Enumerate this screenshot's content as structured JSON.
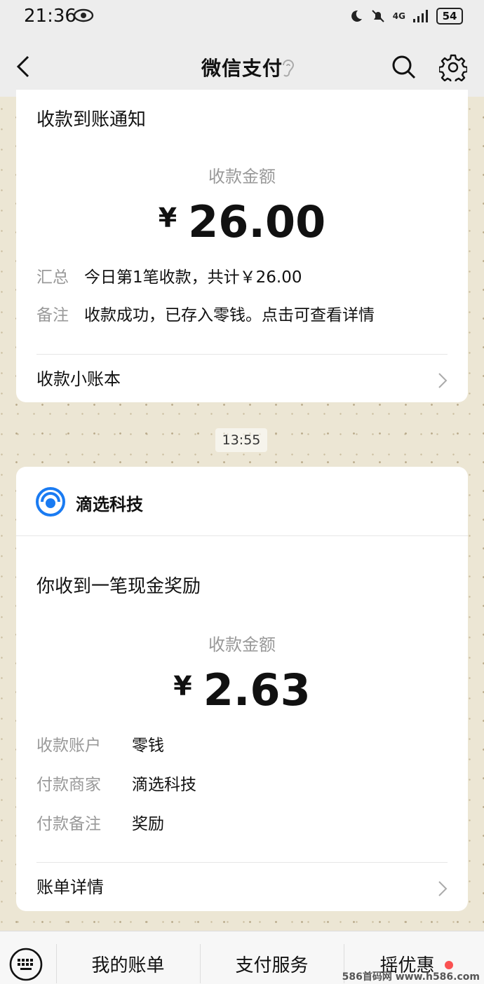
{
  "status_bar": {
    "time": "21:36",
    "network": "4G",
    "battery": "54"
  },
  "header": {
    "title": "微信支付",
    "icons": [
      "back-icon",
      "ear-icon",
      "search-icon",
      "gear-icon"
    ]
  },
  "card1": {
    "title": "收款到账通知",
    "amount_label": "收款金额",
    "currency": "¥",
    "amount": "26.00",
    "rows": [
      {
        "key": "汇总",
        "value": "今日第1笔收款，共计￥26.00"
      },
      {
        "key": "备注",
        "value": "收款成功，已存入零钱。点击可查看详情"
      }
    ],
    "link": "收款小账本"
  },
  "time_badge": "13:55",
  "card2": {
    "brand": "滴选科技",
    "title": "你收到一笔现金奖励",
    "amount_label": "收款金额",
    "currency": "¥",
    "amount": "2.63",
    "rows": [
      {
        "key": "收款账户",
        "value": "零钱"
      },
      {
        "key": "付款商家",
        "value": "滴选科技"
      },
      {
        "key": "付款备注",
        "value": "奖励"
      }
    ],
    "link": "账单详情"
  },
  "bottom_bar": {
    "items": [
      "我的账单",
      "支付服务",
      "摇优惠"
    ]
  },
  "watermark": "586首码网 www.h586.com",
  "colors": {
    "brand_blue": "#1a7bf2",
    "badge_red": "#fa5151"
  }
}
